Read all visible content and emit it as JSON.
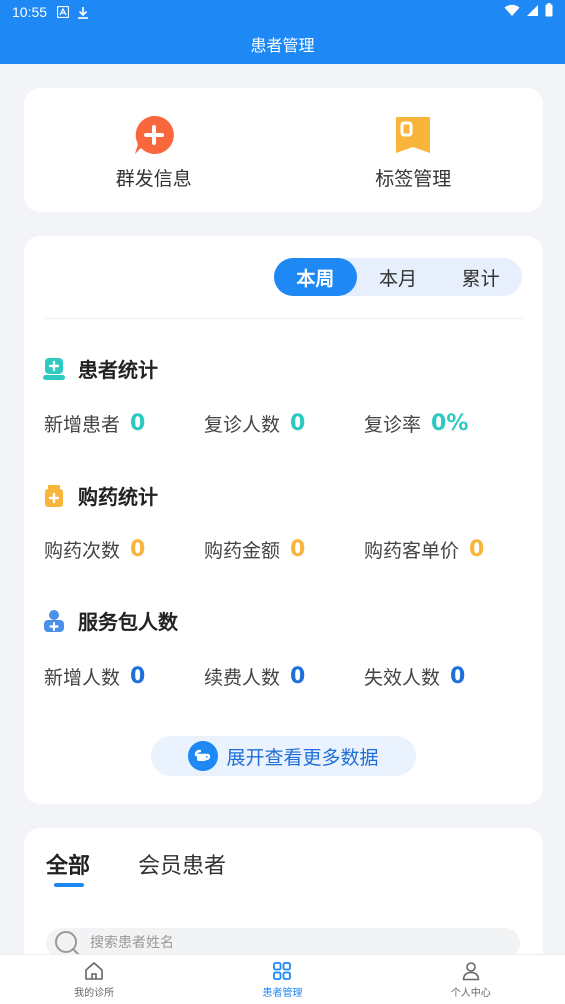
{
  "status_bar": {
    "time": "10:55"
  },
  "header": {
    "title": "患者管理"
  },
  "quick_actions": [
    {
      "label": "群发信息",
      "icon": "chat-plus-icon",
      "color": "#f9683c"
    },
    {
      "label": "标签管理",
      "icon": "tag-icon",
      "color": "#f9b43c"
    }
  ],
  "period_tabs": [
    {
      "label": "本周",
      "active": true
    },
    {
      "label": "本月",
      "active": false
    },
    {
      "label": "累计",
      "active": false
    }
  ],
  "sections": {
    "patients": {
      "title": "患者统计",
      "stats": [
        {
          "label": "新增患者",
          "value": "0"
        },
        {
          "label": "复诊人数",
          "value": "0"
        },
        {
          "label": "复诊率",
          "value": "0%"
        }
      ]
    },
    "purchases": {
      "title": "购药统计",
      "stats": [
        {
          "label": "购药次数",
          "value": "0"
        },
        {
          "label": "购药金额",
          "value": "0"
        },
        {
          "label": "购药客单价",
          "value": "0"
        }
      ]
    },
    "service_packages": {
      "title": "服务包人数",
      "stats": [
        {
          "label": "新增人数",
          "value": "0"
        },
        {
          "label": "续费人数",
          "value": "0"
        },
        {
          "label": "失效人数",
          "value": "0"
        }
      ]
    }
  },
  "expand_button": {
    "label": "展开查看更多数据"
  },
  "list_tabs": [
    {
      "label": "全部",
      "active": true
    },
    {
      "label": "会员患者",
      "active": false
    }
  ],
  "search": {
    "placeholder": "搜索患者姓名"
  },
  "bottom_nav": [
    {
      "label": "我的诊所",
      "icon": "home-icon",
      "active": false
    },
    {
      "label": "患者管理",
      "icon": "grid-icon",
      "active": true
    },
    {
      "label": "个人中心",
      "icon": "person-icon",
      "active": false
    }
  ],
  "colors": {
    "primary": "#1e88f5",
    "teal": "#2ec9c0",
    "orange": "#f9b43c",
    "blue": "#1e6fd8"
  }
}
